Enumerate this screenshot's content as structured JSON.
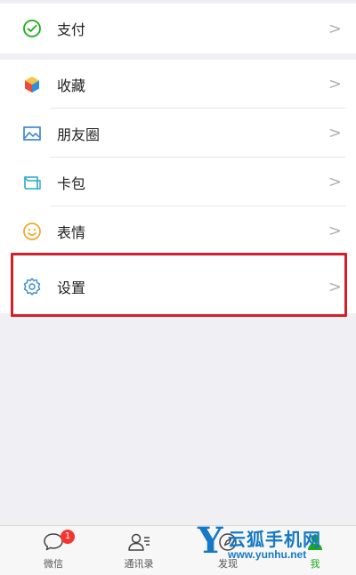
{
  "menu": {
    "pay": {
      "label": "支付",
      "icon": "wallet-icon",
      "color": "#1aad19"
    },
    "items": [
      {
        "label": "收藏",
        "icon": "cube-icon"
      },
      {
        "label": "朋友圈",
        "icon": "image-icon",
        "color": "#2f7fd6"
      },
      {
        "label": "卡包",
        "icon": "card-icon",
        "color": "#2aa7c9"
      },
      {
        "label": "表情",
        "icon": "smiley-icon",
        "color": "#f5a623"
      }
    ],
    "settings": {
      "label": "设置",
      "icon": "gear-icon",
      "color": "#3b8fd6"
    },
    "chevron": ">"
  },
  "highlight_color": "#d4202a",
  "tabbar": {
    "tabs": [
      {
        "label": "微信",
        "icon": "chat-icon",
        "badge": "1"
      },
      {
        "label": "通讯录",
        "icon": "contacts-icon"
      },
      {
        "label": "发现",
        "icon": "compass-icon"
      },
      {
        "label": "我",
        "icon": "person-icon",
        "active_color": "#1aad19"
      }
    ]
  },
  "watermark": {
    "logo_letter": "Y",
    "title": "云狐手机网",
    "url": "www.yunhu.net"
  }
}
